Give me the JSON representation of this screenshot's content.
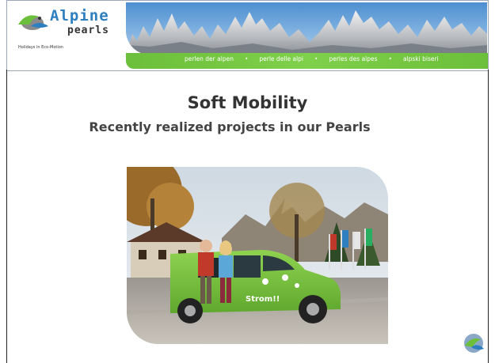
{
  "logo": {
    "brand_top": "Alpine",
    "brand_bottom": "pearls",
    "tagline": "Holidays in Eco-Motion",
    "icon": "alpine-pearls-bird-icon"
  },
  "nav": {
    "links": [
      "perlen der alpen",
      "perle delle alpi",
      "perles des alpes",
      "alpski biseri"
    ],
    "separator": "•"
  },
  "slide": {
    "title": "Soft Mobility",
    "subtitle": "Recently realized projects in our Pearls"
  },
  "colors": {
    "brand_blue": "#2e7fc0",
    "bar_green": "#6cbf3a",
    "van_green": "#7cc242",
    "text_dark": "#333333"
  },
  "photo": {
    "van_text": "Strom!!"
  }
}
